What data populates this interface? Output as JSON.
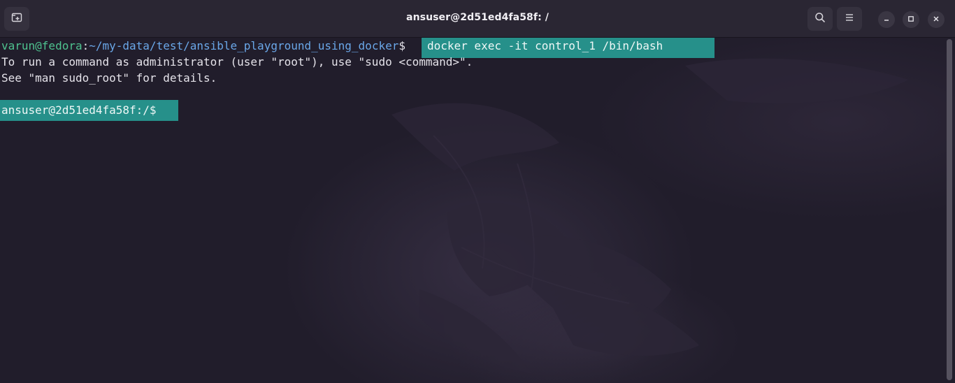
{
  "window": {
    "title": "ansuser@2d51ed4fa58f: /"
  },
  "headerbar": {
    "new_tab_icon": "new-tab-icon",
    "search_icon": "search-icon",
    "menu_icon": "hamburger-menu-icon",
    "minimize_icon": "minimize-icon",
    "maximize_icon": "maximize-icon",
    "close_icon": "close-icon"
  },
  "terminal": {
    "line1": {
      "user_host": "varun@fedora",
      "separator": ":",
      "path": "~/my-data/test/ansible_playground_using_docker",
      "symbol": "$",
      "command": "docker exec -it control_1 /bin/bash"
    },
    "line2": "To run a command as administrator (user \"root\"), use \"sudo <command>\".",
    "line3": "See \"man sudo_root\" for details.",
    "line5": {
      "prompt": "ansuser@2d51ed4fa58f:/$"
    }
  },
  "colors": {
    "prompt_user": "#4ec28f",
    "prompt_path": "#6aa7e8",
    "highlight": "#26908a",
    "text": "#e5e3ea",
    "background": "#211d2b",
    "headerbar": "#2a2633"
  }
}
